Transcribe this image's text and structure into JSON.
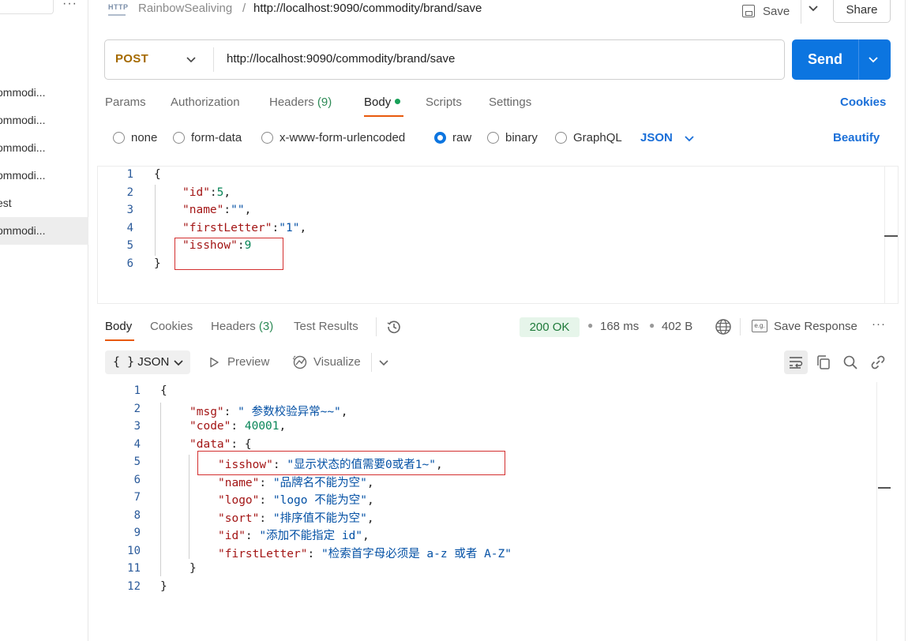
{
  "sidebar": {
    "items": [
      {
        "label": "ommodi..."
      },
      {
        "label": "ommodi..."
      },
      {
        "label": "ommodi..."
      },
      {
        "label": "ommodi..."
      },
      {
        "label": "est"
      },
      {
        "label": "ommodi..."
      }
    ]
  },
  "header": {
    "protocol_icon": "HTTP",
    "collection": "RainbowSealiving",
    "separator": "/",
    "request_name": "http://localhost:9090/commodity/brand/save",
    "save_label": "Save",
    "share_label": "Share"
  },
  "request": {
    "method": "POST",
    "url": "http://localhost:9090/commodity/brand/save",
    "send_label": "Send",
    "tabs": [
      {
        "label": "Params"
      },
      {
        "label": "Authorization"
      },
      {
        "label": "Headers",
        "count": "(9)"
      },
      {
        "label": "Body"
      },
      {
        "label": "Scripts"
      },
      {
        "label": "Settings"
      }
    ],
    "cookies_label": "Cookies",
    "body_types": [
      "none",
      "form-data",
      "x-www-form-urlencoded",
      "raw",
      "binary",
      "GraphQL"
    ],
    "selected_body_type": "raw",
    "format": "JSON",
    "beautify_label": "Beautify",
    "code_lines": [
      {
        "num": "1",
        "text": "{"
      },
      {
        "num": "2",
        "key": "\"id\"",
        "sep": ":",
        "value": "5",
        "tail": ","
      },
      {
        "num": "3",
        "key": "\"name\"",
        "sep": ":",
        "value": "\"\"",
        "tail": ","
      },
      {
        "num": "4",
        "key": "\"firstLetter\"",
        "sep": ":",
        "value": "\"1\"",
        "tail": ","
      },
      {
        "num": "5",
        "key": "\"isshow\"",
        "sep": ":",
        "value": "9",
        "tail": ""
      },
      {
        "num": "6",
        "text": "}"
      }
    ]
  },
  "response": {
    "tabs": [
      {
        "label": "Body"
      },
      {
        "label": "Cookies"
      },
      {
        "label": "Headers",
        "count": "(3)"
      },
      {
        "label": "Test Results"
      }
    ],
    "status": "200 OK",
    "time": "168 ms",
    "size": "402 B",
    "save_response_label": "Save Response",
    "save_response_icon_text": "e.g.",
    "format": "JSON",
    "format_prefix": "{ }",
    "preview_label": "Preview",
    "visualize_label": "Visualize",
    "code_lines": [
      {
        "num": "1",
        "text": "{"
      },
      {
        "num": "2",
        "key": "\"msg\"",
        "value": "\" 参数校验异常~~\"",
        "tail": ","
      },
      {
        "num": "3",
        "key": "\"code\"",
        "value": "40001",
        "tail": ","
      },
      {
        "num": "4",
        "key": "\"data\"",
        "value": "{",
        "tail": ""
      },
      {
        "num": "5",
        "key": "\"isshow\"",
        "value": "\"显示状态的值需要0或者1~\"",
        "tail": ","
      },
      {
        "num": "6",
        "key": "\"name\"",
        "value": "\"品牌名不能为空\"",
        "tail": ","
      },
      {
        "num": "7",
        "key": "\"logo\"",
        "value": "\"logo 不能为空\"",
        "tail": ","
      },
      {
        "num": "8",
        "key": "\"sort\"",
        "value": "\"排序值不能为空\"",
        "tail": ","
      },
      {
        "num": "9",
        "key": "\"id\"",
        "value": "\"添加不能指定 id\"",
        "tail": ","
      },
      {
        "num": "10",
        "key": "\"firstLetter\"",
        "value": "\"检索首字母必须是 a-z 或者 A-Z\"",
        "tail": ""
      },
      {
        "num": "11",
        "text": "}"
      },
      {
        "num": "12",
        "text": "}"
      }
    ]
  },
  "colors": {
    "send_button": "#0c75e0",
    "method": "#a56a00",
    "active_tab_underline": "#e8590c",
    "status_ok_bg": "#e6f5ea",
    "highlight_box": "#d32f2f"
  }
}
